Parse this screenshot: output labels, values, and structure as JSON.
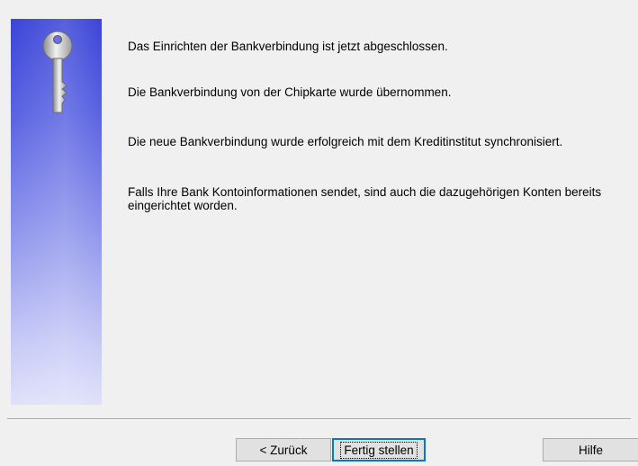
{
  "side_panel": {
    "icon": "key-icon"
  },
  "messages": [
    "Das Einrichten der Bankverbindung ist jetzt abgeschlossen.",
    "Die Bankverbindung von der Chipkarte wurde übernommen.",
    "Die neue Bankverbindung wurde erfolgreich mit dem Kreditinstitut synchronisiert.",
    "Falls Ihre Bank Kontoinformationen sendet, sind auch die dazugehörigen Konten bereits eingerichtet worden."
  ],
  "buttons": {
    "back_label": "< Zurück",
    "finish_label": "Fertig stellen",
    "help_label": "Hilfe"
  },
  "colors": {
    "panel_top": "#3b44d8",
    "panel_bottom": "#dfe1fa",
    "focus_border": "#0078d7"
  }
}
